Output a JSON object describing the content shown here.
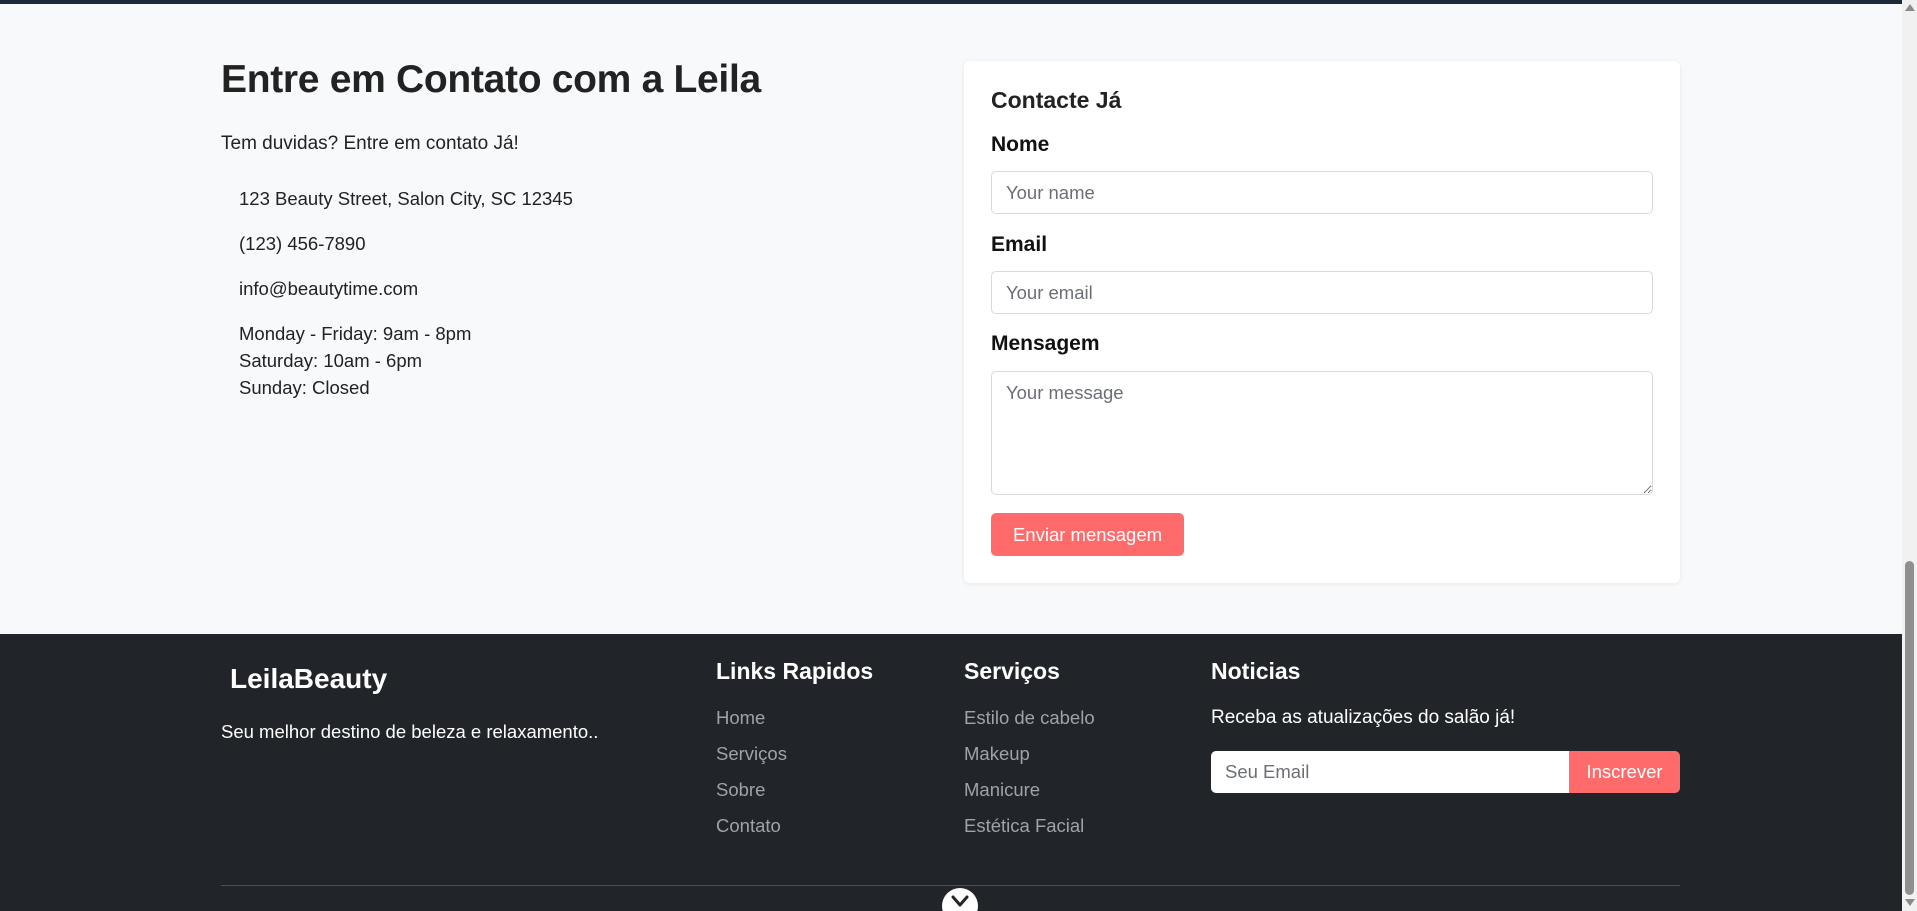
{
  "contact": {
    "title": "Entre em Contato com a Leila",
    "subtitle": "Tem duvidas? Entre em contato Já!",
    "address": "123 Beauty Street, Salon City, SC 12345",
    "phone": "(123) 456-7890",
    "email": "info@beautytime.com",
    "hours": [
      "Monday - Friday: 9am - 8pm",
      "Saturday: 10am - 6pm",
      "Sunday: Closed"
    ]
  },
  "form": {
    "title": "Contacte Já",
    "name_label": "Nome",
    "name_placeholder": "Your name",
    "email_label": "Email",
    "email_placeholder": "Your email",
    "message_label": "Mensagem",
    "message_placeholder": "Your message",
    "submit_label": "Enviar mensagem"
  },
  "footer": {
    "brand": "LeilaBeauty",
    "tagline": "Seu melhor destino de beleza e relaxamento..",
    "quick_links": {
      "title": "Links Rapidos",
      "items": [
        "Home",
        "Serviços",
        "Sobre",
        "Contato"
      ]
    },
    "services": {
      "title": "Serviços",
      "items": [
        "Estilo de cabelo",
        "Makeup",
        "Manicure",
        "Estética Facial"
      ]
    },
    "newsletter": {
      "title": "Noticias",
      "text": "Receba as atualizações do salão já!",
      "input_placeholder": "Seu Email",
      "button_label": "Inscrever"
    }
  },
  "colors": {
    "accent": "#ff6b6b",
    "footer_bg": "#212529",
    "page_bg": "#f8f9fb"
  },
  "icons": {
    "scroll_top": "chevron-up-icon"
  }
}
